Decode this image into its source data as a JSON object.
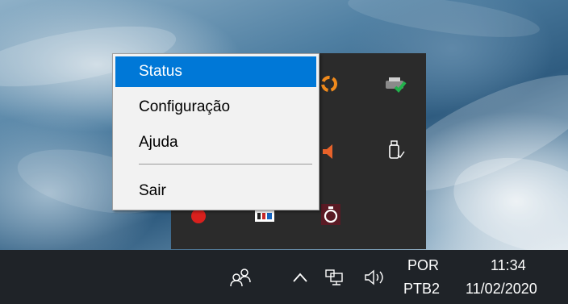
{
  "context_menu": {
    "items": [
      {
        "label": "Status",
        "selected": true
      },
      {
        "label": "Configuração",
        "selected": false
      },
      {
        "label": "Ajuda",
        "selected": false
      },
      {
        "label": "Sair",
        "selected": false
      }
    ]
  },
  "tray_overflow": {
    "icons": [
      "orange-app-icon",
      "printer-ok-icon",
      "speaker-app-icon",
      "usb-eject-icon",
      "red-app-icon",
      "pjb-app-icon",
      "timer-app-icon"
    ]
  },
  "taskbar": {
    "language": "POR",
    "keyboard_layout": "PTB2",
    "time": "11:34",
    "date": "11/02/2020",
    "accent_color": "#0078d7",
    "taskbar_color": "#1f2328"
  }
}
